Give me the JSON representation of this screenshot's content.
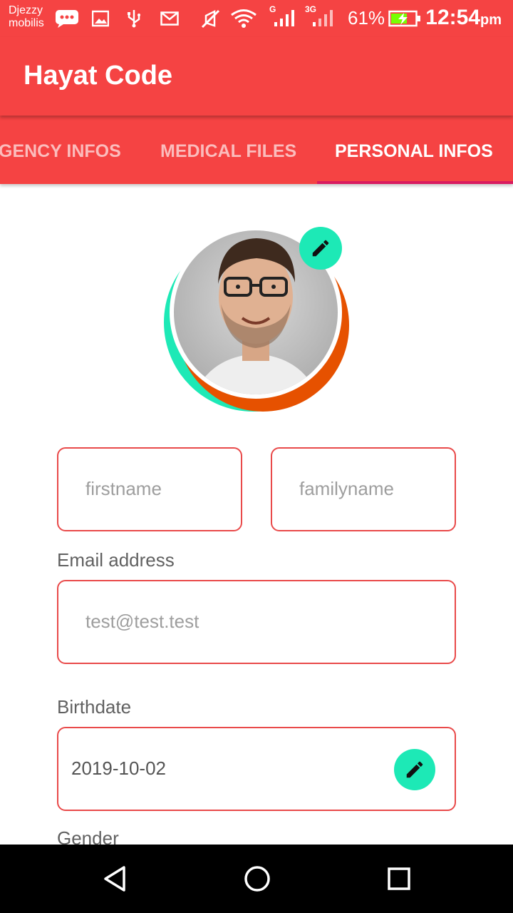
{
  "status_bar": {
    "carrier_line1": "Djezzy",
    "carrier_line2": "mobilis",
    "network_g": "G",
    "network_3g": "3G",
    "battery": "61%",
    "time": "12:54",
    "time_suffix": "pm"
  },
  "app_bar": {
    "title": "Hayat Code"
  },
  "tabs": [
    {
      "label": "GENCY INFOS",
      "active": false
    },
    {
      "label": "MEDICAL FILES",
      "active": false
    },
    {
      "label": "PERSONAL INFOS",
      "active": true
    }
  ],
  "form": {
    "firstname_placeholder": "firstname",
    "familyname_placeholder": "familyname",
    "email_label": "Email address",
    "email_placeholder": "test@test.test",
    "birthdate_label": "Birthdate",
    "birthdate_value": "2019-10-02",
    "gender_label": "Gender"
  },
  "colors": {
    "primary": "#f54343",
    "accent": "#1de9b6",
    "tab_indicator": "#d81b60",
    "field_border": "#e94a4a"
  },
  "icons": [
    "image-icon",
    "usb-icon",
    "mail-icon",
    "mute-icon",
    "wifi-icon",
    "signal-icon",
    "battery-icon",
    "pencil-icon",
    "back-icon",
    "home-icon",
    "recents-icon"
  ]
}
